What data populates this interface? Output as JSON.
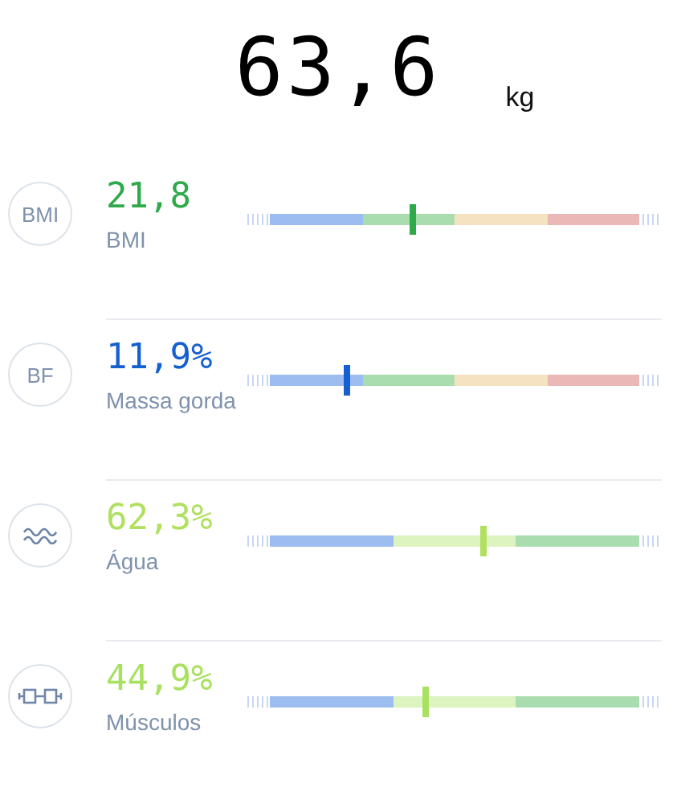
{
  "weight": {
    "value": "63,6",
    "unit": "kg"
  },
  "metrics": [
    {
      "icon": {
        "kind": "text",
        "text": "BMI"
      },
      "value": "21,8",
      "label": "BMI",
      "color": "#2eaa4a",
      "level": 0.4,
      "segments": [
        {
          "color": "#9dbcf0"
        },
        {
          "color": "#a9dcae"
        },
        {
          "color": "#f5e2c0"
        },
        {
          "color": "#ebb8b8"
        }
      ]
    },
    {
      "icon": {
        "kind": "text",
        "text": "BF"
      },
      "value": "11,9%",
      "label": "Massa gorda",
      "color": "#1560d0",
      "level": 0.24,
      "segments": [
        {
          "color": "#9dbcf0"
        },
        {
          "color": "#a9dcae"
        },
        {
          "color": "#f5e2c0"
        },
        {
          "color": "#ebb8b8"
        }
      ]
    },
    {
      "icon": {
        "kind": "wave"
      },
      "value": "62,3%",
      "label": "Água",
      "color": "#b0e060",
      "level": 0.57,
      "segments": [
        {
          "color": "#9dbcf0"
        },
        {
          "color": "#ddf3c0"
        },
        {
          "color": "#a9dcae"
        }
      ]
    },
    {
      "icon": {
        "kind": "dumbbell"
      },
      "value": "44,9%",
      "label": "Músculos",
      "color": "#a8e060",
      "level": 0.43,
      "segments": [
        {
          "color": "#9dbcf0"
        },
        {
          "color": "#ddf3c0"
        },
        {
          "color": "#a9dcae"
        }
      ]
    }
  ]
}
